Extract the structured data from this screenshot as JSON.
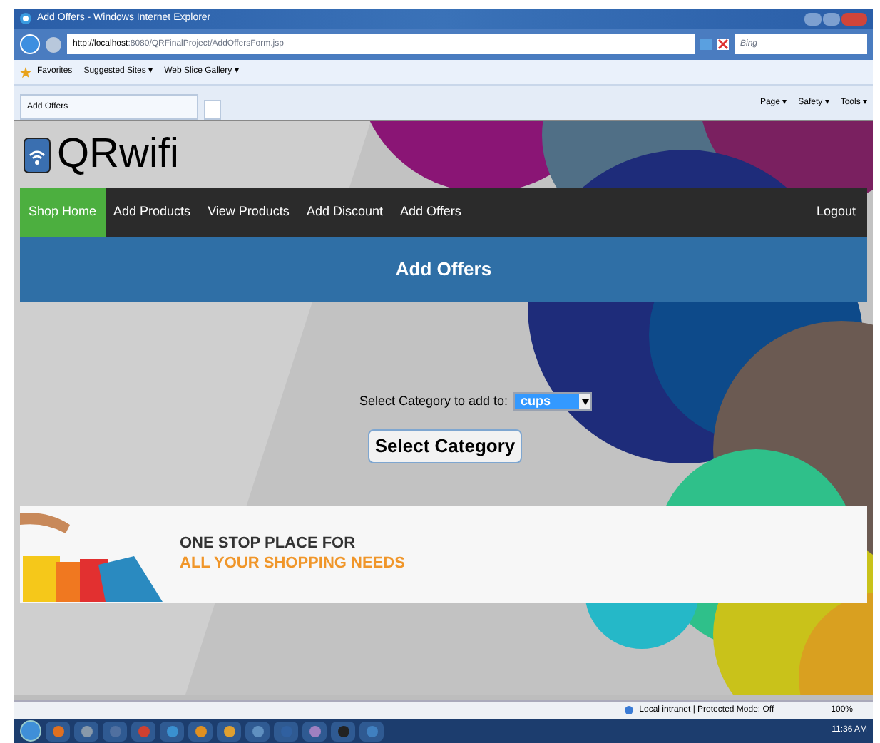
{
  "window": {
    "title": "Add Offers - Windows Internet Explorer"
  },
  "address_bar": {
    "url_host": "http://localhost",
    "url_rest": ":8080/QRFinalProject/AddOffersForm.jsp",
    "search_placeholder": "Bing"
  },
  "favorites_bar": {
    "label": "Favorites",
    "links": [
      "Suggested Sites ▾",
      "Web Slice Gallery ▾"
    ]
  },
  "tab": {
    "label": "Add Offers"
  },
  "command_bar": [
    "Page ▾",
    "Safety ▾",
    "Tools ▾"
  ],
  "site": {
    "logo": "QRwifi",
    "nav": [
      {
        "label": "Shop Home",
        "selected": true
      },
      {
        "label": "Add Products",
        "selected": false
      },
      {
        "label": "View Products",
        "selected": false
      },
      {
        "label": "Add Discount",
        "selected": false
      },
      {
        "label": "Add Offers",
        "selected": false
      }
    ],
    "logout": "Logout",
    "heading": "Add Offers",
    "form": {
      "label": "Select Category to add to:",
      "select_value": "cups",
      "button": "Select Category"
    },
    "banner": {
      "line_1": "ONE STOP PLACE FOR",
      "line_2": "ALL YOUR SHOPPING NEEDS"
    }
  },
  "status_bar": {
    "zone": "Local intranet | Protected Mode: Off",
    "zoom": "100%"
  },
  "taskbar": {
    "clock": "11:36 AM"
  }
}
